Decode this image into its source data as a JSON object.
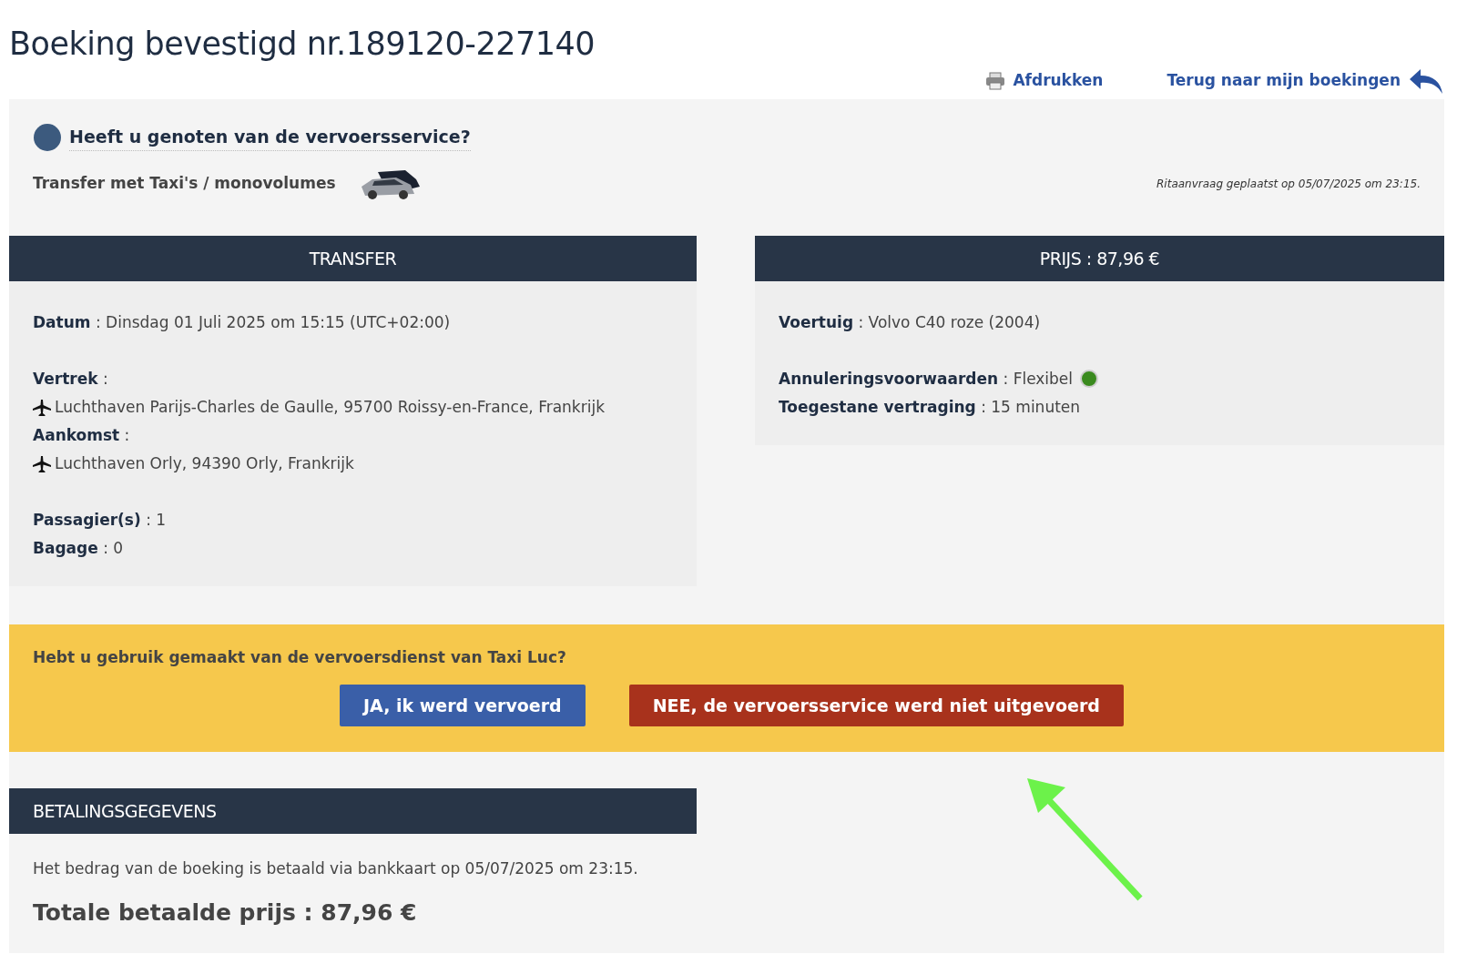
{
  "title": "Boeking bevestigd nr.189120-227140",
  "top_links": [
    {
      "label": "Afdrukken",
      "kind": "print"
    },
    {
      "label": "Terug naar mijn boekingen",
      "kind": "back"
    }
  ],
  "info": {
    "question": "Heeft u genoten van de vervoersservice?",
    "service": "Transfer met Taxi's / monovolumes",
    "requested": "Ritaanvraag geplaatst op 05/07/2025 om 23:15."
  },
  "transfer": {
    "header": "TRANSFER",
    "lines": [
      {
        "kind": "field",
        "text": "**Datum** : Dinsdag 01 Juli 2025 om 15:15 (UTC+02:00)"
      },
      {
        "kind": "gap"
      },
      {
        "kind": "field",
        "text": "**Vertrek** :"
      },
      {
        "kind": "place",
        "value": "Luchthaven Parijs-Charles de Gaulle, 95700 Roissy-en-France, Frankrijk"
      },
      {
        "kind": "field",
        "text": "**Aankomst** :"
      },
      {
        "kind": "place",
        "value": "Luchthaven Orly, 94390 Orly, Frankrijk"
      },
      {
        "kind": "gap"
      },
      {
        "kind": "field",
        "text": "**Passagier(s)** : 1"
      },
      {
        "kind": "field",
        "text": "**Bagage** : 0"
      }
    ]
  },
  "price": {
    "header": "PRIJS : 87,96 €",
    "lines": [
      {
        "kind": "field",
        "text": "**Voertuig** : Volvo C40 roze (2004)"
      },
      {
        "kind": "gap"
      },
      {
        "kind": "field",
        "text": "**Annuleringsvoorwaarden** : Flexibel",
        "color": "#3a8a1e"
      },
      {
        "kind": "field",
        "text": "**Toegestane vertraging** : 15 minuten"
      }
    ]
  },
  "feedback": {
    "question": "Hebt u gebruik gemaakt van de vervoersdienst van Taxi Luc?",
    "buttons": [
      {
        "label": "JA, ik werd vervoerd",
        "kind": "yes"
      },
      {
        "label": "NEE, de vervoersservice werd niet uitgevoerd",
        "kind": "no"
      }
    ]
  },
  "payment": {
    "header": "BETALINGSGEGEVENS",
    "text": "Het bedrag van de boeking is betaald via bankkaart op 05/07/2025 om 23:15.",
    "total": "Totale betaalde prijs : 87,96 €"
  }
}
